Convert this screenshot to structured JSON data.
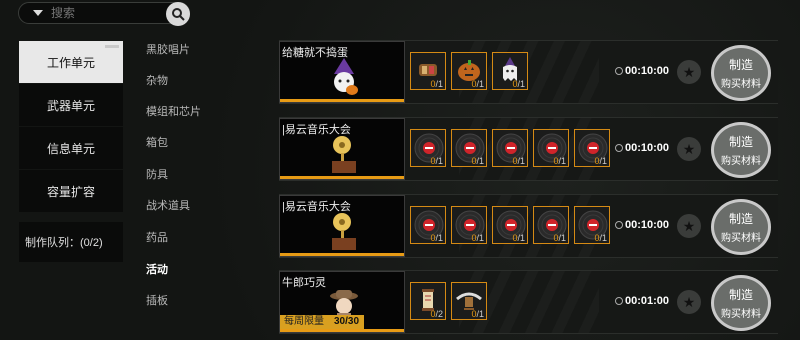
{
  "search": {
    "placeholder": "搜索",
    "icon": "search-icon",
    "dropdown_icon": "triangle-down-icon"
  },
  "nav": [
    {
      "label": "工作单元",
      "active": true
    },
    {
      "label": "武器单元",
      "active": false
    },
    {
      "label": "信息单元",
      "active": false
    },
    {
      "label": "容量扩容",
      "active": false
    }
  ],
  "queue": {
    "label": "制作队列：(0/2)"
  },
  "categories": [
    {
      "label": "黑胶唱片",
      "active": false
    },
    {
      "label": "杂物",
      "active": false
    },
    {
      "label": "模组和芯片",
      "active": false
    },
    {
      "label": "箱包",
      "active": false
    },
    {
      "label": "防具",
      "active": false
    },
    {
      "label": "战术道具",
      "active": false
    },
    {
      "label": "药品",
      "active": false
    },
    {
      "label": "活动",
      "active": true
    },
    {
      "label": "插板",
      "active": false
    }
  ],
  "recipes": [
    {
      "title": "给糖就不捣蛋",
      "time": "00:10:00",
      "materials": [
        {
          "icon": "candy-icon",
          "have": "0",
          "need": "1"
        },
        {
          "icon": "pumpkin-icon",
          "have": "0",
          "need": "1"
        },
        {
          "icon": "ghost-icon",
          "have": "0",
          "need": "1"
        }
      ],
      "craft": "制造",
      "buy": "购买材料"
    },
    {
      "title": "|易云音乐大会",
      "time": "00:10:00",
      "materials": [
        {
          "icon": "vinyl-record-icon",
          "have": "0",
          "need": "1"
        },
        {
          "icon": "vinyl-record-icon",
          "have": "0",
          "need": "1"
        },
        {
          "icon": "vinyl-record-icon",
          "have": "0",
          "need": "1"
        },
        {
          "icon": "vinyl-record-icon",
          "have": "0",
          "need": "1"
        },
        {
          "icon": "vinyl-record-icon",
          "have": "0",
          "need": "1"
        }
      ],
      "craft": "制造",
      "buy": "购买材料"
    },
    {
      "title": "|易云音乐大会",
      "time": "00:10:00",
      "materials": [
        {
          "icon": "vinyl-record-icon",
          "have": "0",
          "need": "1"
        },
        {
          "icon": "vinyl-record-icon",
          "have": "0",
          "need": "1"
        },
        {
          "icon": "vinyl-record-icon",
          "have": "0",
          "need": "1"
        },
        {
          "icon": "vinyl-record-icon",
          "have": "0",
          "need": "1"
        },
        {
          "icon": "vinyl-record-icon",
          "have": "0",
          "need": "1"
        }
      ],
      "craft": "制造",
      "buy": "购买材料"
    },
    {
      "title": "牛郎巧灵",
      "time": "00:01:00",
      "limit_label": "每周限量",
      "limit_value": "30/30",
      "materials": [
        {
          "icon": "scroll-icon",
          "have": "0",
          "need": "2"
        },
        {
          "icon": "magpie-bridge-icon",
          "have": "0",
          "need": "1"
        }
      ],
      "craft": "制造",
      "buy": "购买材料"
    }
  ],
  "accent": "#e79b15"
}
